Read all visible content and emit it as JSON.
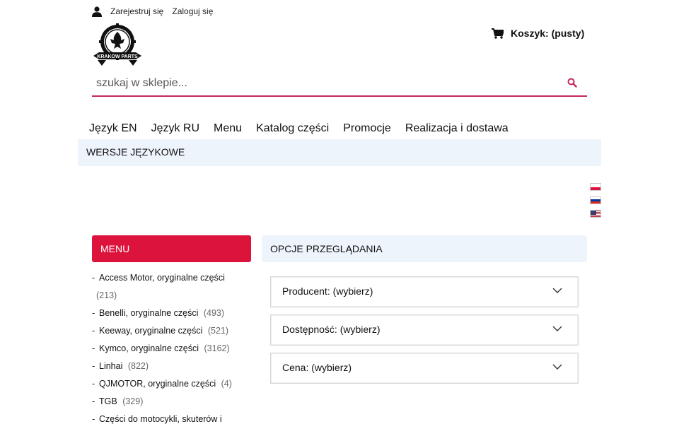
{
  "header": {
    "register": "Zarejestruj się",
    "login": "Zaloguj się",
    "logo_text": "KRAKOW PARTS",
    "cart_label": "Koszyk:",
    "cart_status": "(pusty)"
  },
  "search": {
    "placeholder": "szukaj w sklepie..."
  },
  "nav": {
    "items": [
      {
        "label": "Język EN"
      },
      {
        "label": "Język RU"
      },
      {
        "label": "Menu"
      },
      {
        "label": "Katalog części"
      },
      {
        "label": "Promocje"
      },
      {
        "label": "Realizacja i dostawa"
      }
    ]
  },
  "lang_bar": {
    "title": "WERSJE JĘZYKOWE",
    "flags": [
      "polish-flag-icon",
      "russian-flag-icon",
      "us-flag-icon"
    ]
  },
  "sidebar": {
    "title": "MENU",
    "items": [
      {
        "label": "Access Motor, oryginalne części",
        "count": "(213)"
      },
      {
        "label": "Benelli, oryginalne części",
        "count": "(493)"
      },
      {
        "label": "Keeway, oryginalne części",
        "count": "(521)"
      },
      {
        "label": "Kymco, oryginalne części",
        "count": "(3162)"
      },
      {
        "label": "Linhai",
        "count": "(822)"
      },
      {
        "label": "QJMOTOR, oryginalne części",
        "count": "(4)"
      },
      {
        "label": "TGB",
        "count": "(329)"
      },
      {
        "label": "Części do motocykli, skuterów i",
        "count": ""
      }
    ]
  },
  "options": {
    "title": "OPCJE PRZEGLĄDANIA",
    "filters": [
      {
        "label": "Producent: (wybierz)"
      },
      {
        "label": "Dostępność: (wybierz)"
      },
      {
        "label": "Cena: (wybierz)"
      }
    ]
  },
  "colors": {
    "accent": "#dc143c",
    "search_underline": "#c5285a",
    "panel_bg": "#eef4fc"
  }
}
